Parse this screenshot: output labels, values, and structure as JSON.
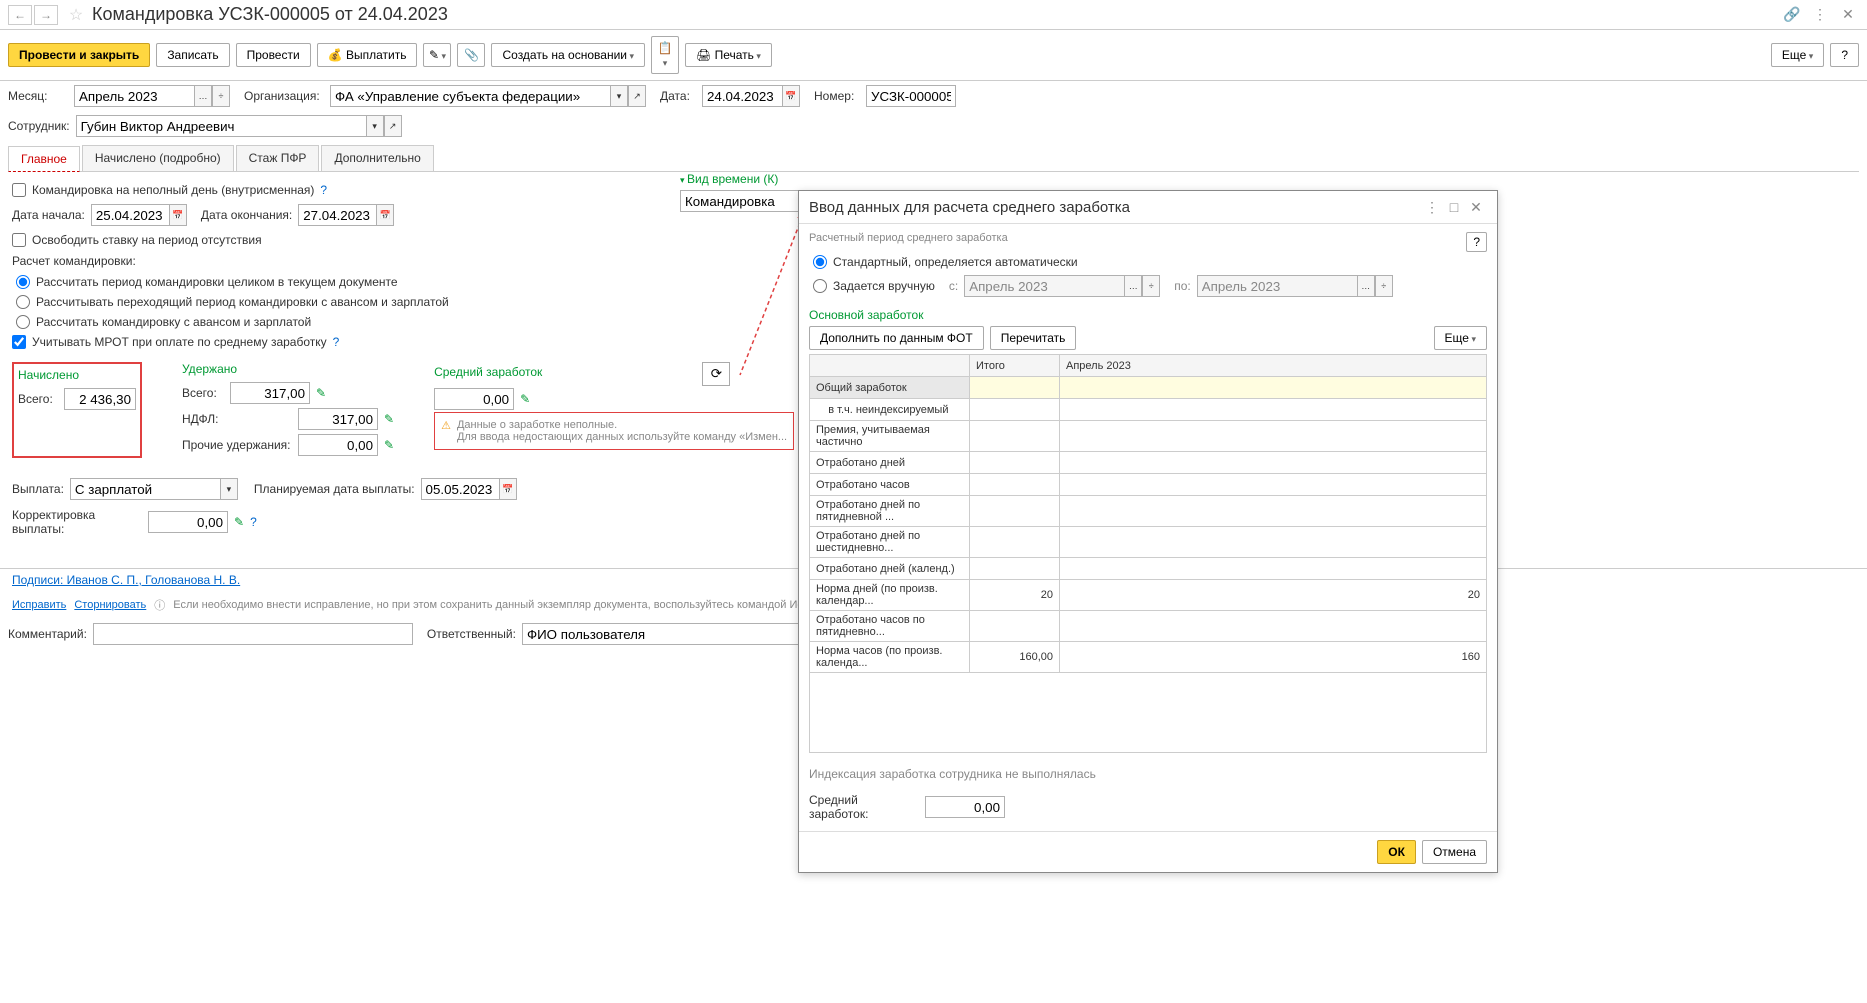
{
  "header": {
    "title": "Командировка УСЗК-000005 от 24.04.2023"
  },
  "toolbar": {
    "post_close": "Провести и закрыть",
    "save": "Записать",
    "post": "Провести",
    "pay": "Выплатить",
    "create_based": "Создать на основании",
    "print": "Печать",
    "more": "Еще",
    "help": "?"
  },
  "form": {
    "month_lbl": "Месяц:",
    "month_val": "Апрель 2023",
    "org_lbl": "Организация:",
    "org_val": "ФА «Управление субъекта федерации»",
    "date_lbl": "Дата:",
    "date_val": "24.04.2023",
    "num_lbl": "Номер:",
    "num_val": "УСЗК-000005",
    "emp_lbl": "Сотрудник:",
    "emp_val": "Губин Виктор Андреевич"
  },
  "tabs": {
    "main": "Главное",
    "accrued": "Начислено (подробно)",
    "pfr": "Стаж ПФР",
    "extra": "Дополнительно"
  },
  "main": {
    "partial_day": "Командировка на неполный день (внутрисменная)",
    "start_lbl": "Дата начала:",
    "start_val": "25.04.2023",
    "end_lbl": "Дата окончания:",
    "end_val": "27.04.2023",
    "free_rate": "Освободить ставку на период отсутствия",
    "calc_title": "Расчет командировки:",
    "r1": "Рассчитать период командировки целиком в текущем документе",
    "r2": "Рассчитывать переходящий период командировки с авансом и зарплатой",
    "r3": "Рассчитать командировку с авансом и зарплатой",
    "mrot": "Учитывать МРОТ при оплате по среднему заработку",
    "time_type_link": "Вид времени (К)",
    "time_type_val": "Командировка",
    "accrued_title": "Начислено",
    "withheld_title": "Удержано",
    "avg_title": "Средний заработок",
    "total_lbl": "Всего:",
    "accrued_total": "2 436,30",
    "withheld_total": "317,00",
    "avg_val": "0,00",
    "ndfl_lbl": "НДФЛ:",
    "ndfl_val": "317,00",
    "other_lbl": "Прочие удержания:",
    "other_val": "0,00",
    "warn_line1": "Данные о заработке неполные.",
    "warn_line2": "Для ввода недостающих данных используйте команду «Измен...",
    "payout_lbl": "Выплата:",
    "payout_val": "С зарплатой",
    "plan_date_lbl": "Планируемая дата выплаты:",
    "plan_date_val": "05.05.2023",
    "corr_lbl": "Корректировка выплаты:",
    "corr_val": "0,00"
  },
  "footer": {
    "signs": "Подписи: Иванов С. П., Голованова Н. В.",
    "fix": "Исправить",
    "storno": "Сторнировать",
    "info": "Если необходимо внести исправление, но при этом сохранить данный экземпляр документа, воспользуйтесь командой Исправи...",
    "comment_lbl": "Комментарий:",
    "resp_lbl": "Ответственный:",
    "resp_val": "ФИО пользователя"
  },
  "popup": {
    "title": "Ввод данных для расчета среднего заработка",
    "sub": "Расчетный период среднего заработка",
    "r_std": "Стандартный, определяется автоматически",
    "r_manual": "Задается вручную",
    "from_lbl": "с:",
    "from_val": "Апрель 2023",
    "to_lbl": "по:",
    "to_val": "Апрель 2023",
    "earning_title": "Основной заработок",
    "fill_fot": "Дополнить по данным ФОТ",
    "recalc": "Перечитать",
    "more": "Еще",
    "col_total": "Итого",
    "col_apr": "Апрель 2023",
    "rows": [
      {
        "label": "Общий заработок",
        "total": "",
        "apr": ""
      },
      {
        "label": "    в т.ч. неиндексируемый",
        "total": "",
        "apr": ""
      },
      {
        "label": "Премия, учитываемая частично",
        "total": "",
        "apr": ""
      },
      {
        "label": "Отработано дней",
        "total": "",
        "apr": ""
      },
      {
        "label": "Отработано часов",
        "total": "",
        "apr": ""
      },
      {
        "label": "Отработано дней по пятидневной ...",
        "total": "",
        "apr": ""
      },
      {
        "label": "Отработано дней по шестидневно...",
        "total": "",
        "apr": ""
      },
      {
        "label": "Отработано дней (календ.)",
        "total": "",
        "apr": ""
      },
      {
        "label": "Норма дней (по произв. календар...",
        "total": "20",
        "apr": "20"
      },
      {
        "label": "Отработано часов по пятидневно...",
        "total": "",
        "apr": ""
      },
      {
        "label": "Норма часов (по произв. календа...",
        "total": "160,00",
        "apr": "160"
      }
    ],
    "index_note": "Индексация заработка сотрудника не выполнялась",
    "avg_lbl": "Средний заработок:",
    "avg_val": "0,00",
    "ok": "ОК",
    "cancel": "Отмена",
    "help": "?"
  }
}
